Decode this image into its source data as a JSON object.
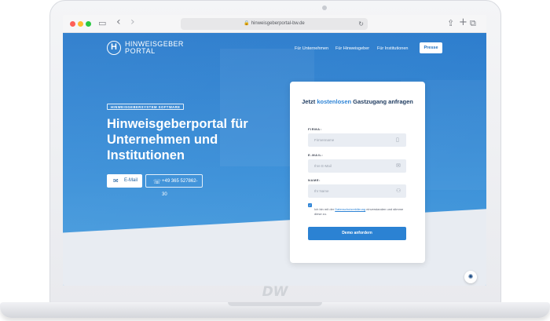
{
  "browser": {
    "url": "hinweisgeberportal-bw.de",
    "back_icon": "‹",
    "forward_icon": "›",
    "sidebar_icon": "▭",
    "reload_icon": "↻",
    "share_icon": "⇪",
    "new_tab_icon": "+",
    "tabs_icon": "⧉"
  },
  "site": {
    "logo": {
      "mark": "H",
      "line1": "HINWEISGEBER",
      "line2": "PORTAL"
    },
    "nav": [
      "Für Unternehmen",
      "Für Hinweisgeber",
      "Für Institutionen"
    ],
    "press_label": "Presse",
    "tagline": "HINWEISGEBERSYSTEM SOFTWARE",
    "headline": "Hinweisgeberportal für Unternehmen und Institutionen",
    "mail_button": "E-Mail",
    "phone_button": "+49 365 527862-30",
    "form": {
      "title_prefix": "Jetzt ",
      "title_highlight": "kostenlosen",
      "title_suffix": " Gastzugang anfragen",
      "company_label": "FIRMA:",
      "company_placeholder": "Firmenname",
      "email_label": "E-MAIL:",
      "email_placeholder": "Ihre E-Mail",
      "name_label": "NAME:",
      "name_placeholder": "Ihr Name",
      "consent_prefix": "Ich bin mit der ",
      "consent_link": "Datenschutzerklärung",
      "consent_suffix": " einverstanden und stimme diese zu.",
      "submit_label": "Demo anfordern"
    },
    "cookie_icon": "✺"
  },
  "brand_mark": "DW",
  "colors": {
    "primary": "#2b82d3",
    "hero": "#3a8fd8",
    "title": "#1d3a5f"
  }
}
